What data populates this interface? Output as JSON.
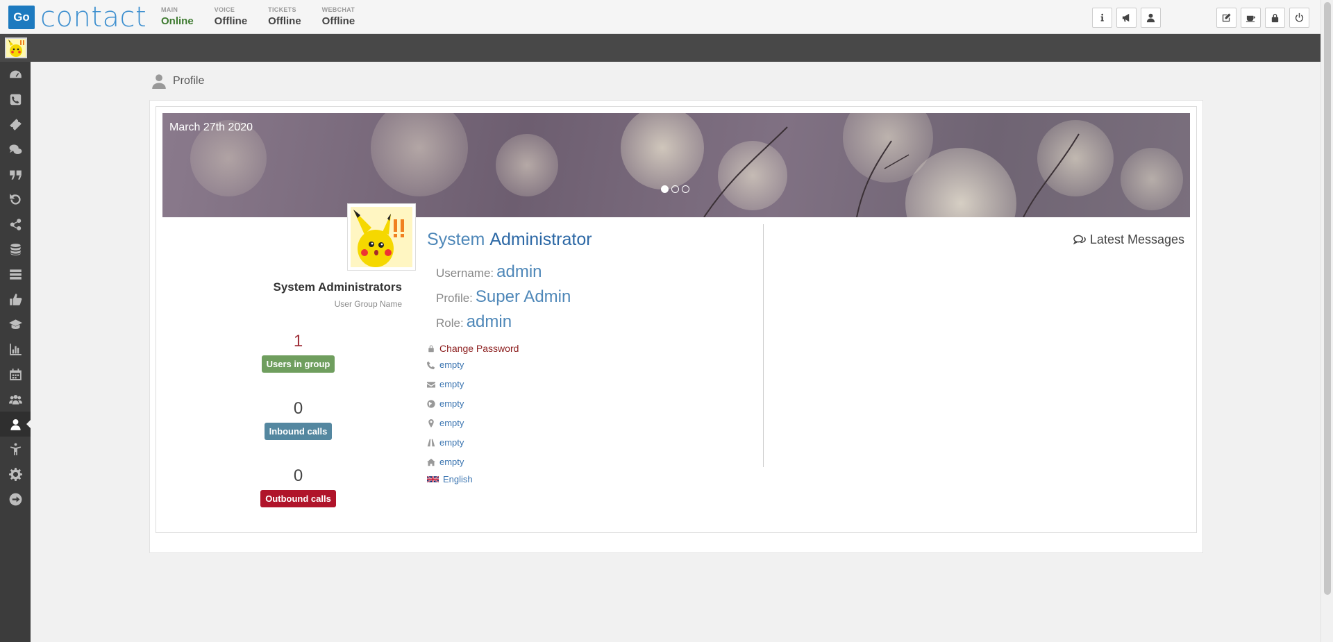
{
  "app": {
    "logo_go": "Go",
    "logo_text": "contact"
  },
  "statuses": [
    {
      "label": "MAIN",
      "value": "Online"
    },
    {
      "label": "VOICE",
      "value": "Offline"
    },
    {
      "label": "TICKETS",
      "value": "Offline"
    },
    {
      "label": "WEBCHAT",
      "value": "Offline"
    }
  ],
  "toolbar_icons": [
    "info-icon",
    "megaphone-icon",
    "user-icon",
    "edit-icon",
    "coffee-icon",
    "lock-icon",
    "power-icon"
  ],
  "sidebar_icons": [
    "dashboard-icon",
    "phone-icon",
    "ticket-icon",
    "chat-icon",
    "quote-icon",
    "undo-icon",
    "share-icon",
    "database-icon",
    "list-icon",
    "thumbs-up-icon",
    "graduation-cap-icon",
    "bar-chart-icon",
    "calendar-icon",
    "users-icon",
    "profile-icon",
    "accessibility-icon",
    "settings-icon",
    "arrow-right-icon"
  ],
  "breadcrumb": {
    "label": "Profile"
  },
  "banner": {
    "date": "March 27th 2020",
    "slides": 3,
    "active_slide": 1
  },
  "group": {
    "name": "System Administrators",
    "subtitle": "User Group Name"
  },
  "stats": [
    {
      "value": "1",
      "label": "Users in group",
      "color": "#6f9e5e"
    },
    {
      "value": "0",
      "label": "Inbound calls",
      "color": "#5487a0"
    },
    {
      "value": "0",
      "label": "Outbound calls",
      "color": "#b0142a"
    }
  ],
  "user": {
    "first_name": "System",
    "last_name": "Administrator",
    "username_label": "Username:",
    "username": "admin",
    "profile_label": "Profile:",
    "profile": "Super Admin",
    "role_label": "Role:",
    "role": "admin"
  },
  "change_password": "Change Password",
  "contact_fields": [
    {
      "icon": "phone-icon",
      "value": "empty"
    },
    {
      "icon": "envelope-icon",
      "value": "empty"
    },
    {
      "icon": "globe-icon",
      "value": "empty"
    },
    {
      "icon": "map-marker-icon",
      "value": "empty"
    },
    {
      "icon": "road-icon",
      "value": "empty"
    },
    {
      "icon": "home-icon",
      "value": "empty"
    }
  ],
  "language": "English",
  "messages": {
    "title": "Latest Messages"
  }
}
